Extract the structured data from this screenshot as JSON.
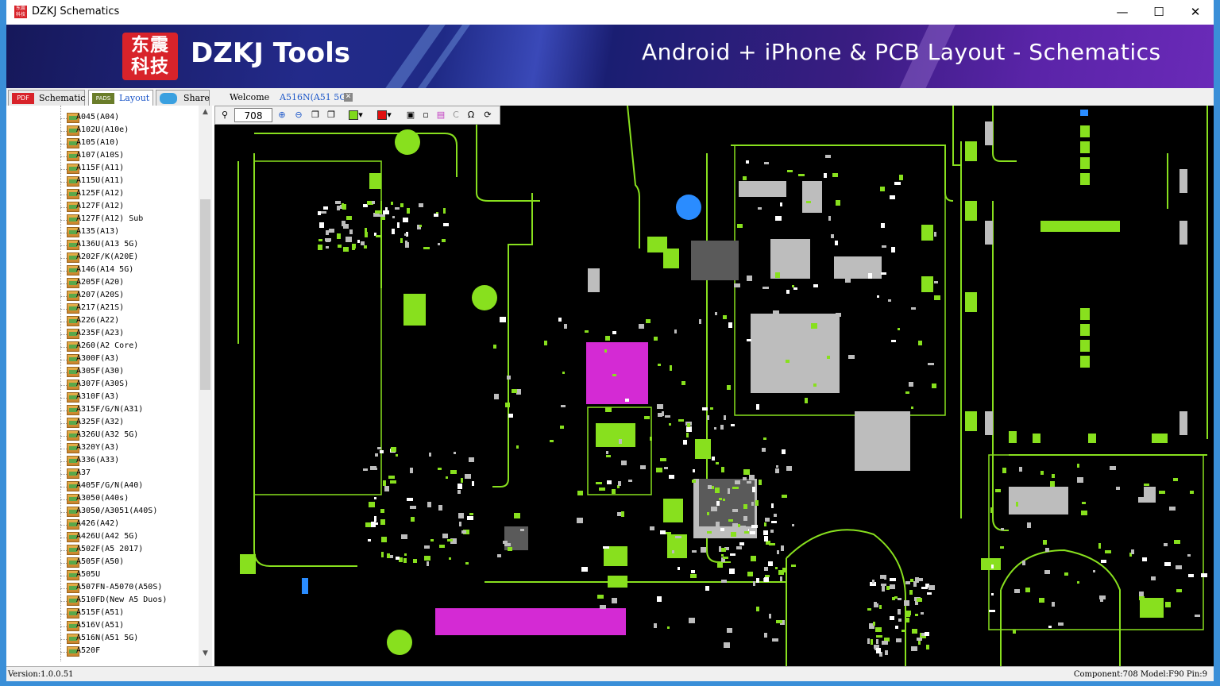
{
  "window": {
    "title": "DZKJ Schematics"
  },
  "banner": {
    "logo_top": "东震",
    "logo_bottom": "科技",
    "brand": "DZKJ Tools",
    "tagline": "Android + iPhone & PCB Layout - Schematics"
  },
  "tabs": [
    {
      "icon": "PDF",
      "label": "Schematic"
    },
    {
      "icon": "PADS",
      "label": "Layout"
    },
    {
      "icon": "",
      "label": "Share"
    }
  ],
  "doc_tabs": {
    "welcome": "Welcome",
    "current": "A516N(A51 5G)"
  },
  "toolbar": {
    "zoom_value": "708"
  },
  "tree": {
    "items": [
      "A045(A04)",
      "A102U(A10e)",
      "A105(A10)",
      "A107(A10S)",
      "A115F(A11)",
      "A115U(A11)",
      "A125F(A12)",
      "A127F(A12)",
      "A127F(A12) Sub",
      "A135(A13)",
      "A136U(A13 5G)",
      "A202F/K(A20E)",
      "A146(A14 5G)",
      "A205F(A20)",
      "A207(A20S)",
      "A217(A21S)",
      "A226(A22)",
      "A235F(A23)",
      "A260(A2 Core)",
      "A300F(A3)",
      "A305F(A30)",
      "A307F(A30S)",
      "A310F(A3)",
      "A315F/G/N(A31)",
      "A325F(A32)",
      "A326U(A32 5G)",
      "A320Y(A3)",
      "A336(A33)",
      "A37",
      "A405F/G/N(A40)",
      "A3050(A40s)",
      "A3050/A3051(A40S)",
      "A426(A42)",
      "A426U(A42 5G)",
      "A502F(A5 2017)",
      "A505F(A50)",
      "A505U",
      "A507FN-A5070(A50S)",
      "A510FD(New A5 Duos)",
      "A515F(A51)",
      "A516V(A51)",
      "A516N(A51 5G)",
      "A520F"
    ]
  },
  "status": {
    "version": "Version:1.0.0.51",
    "info": "Component:708 Model:F90 Pin:9"
  },
  "colors": {
    "pcb_green": "#88e01e",
    "pcb_pad": "#bdbdbd",
    "pcb_magenta": "#d42ad4",
    "pcb_blue": "#2a8cff"
  }
}
